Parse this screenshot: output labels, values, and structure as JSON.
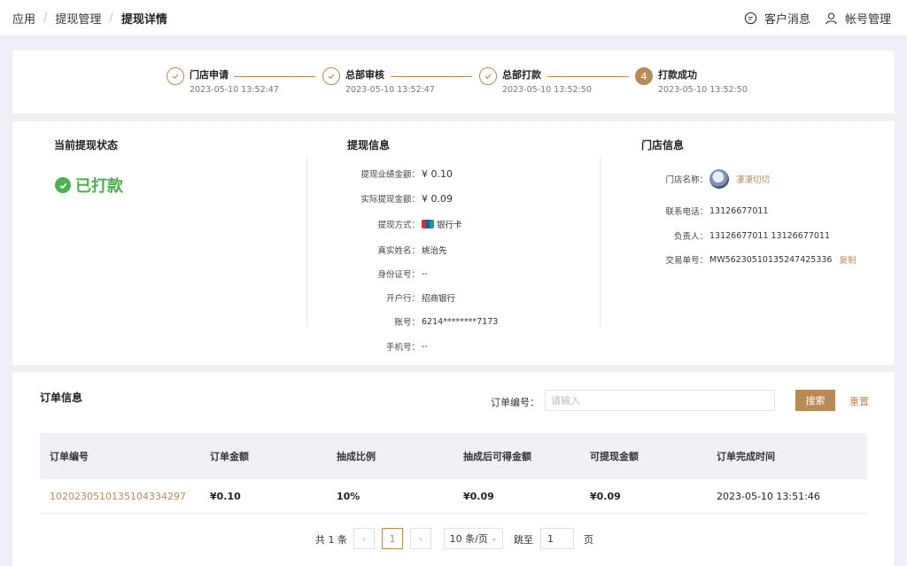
{
  "breadcrumb": {
    "items": [
      "应用",
      "提现管理"
    ],
    "current": "提现详情",
    "separator": "/"
  },
  "header": {
    "messages_label": "客户消息",
    "account_label": "帐号管理"
  },
  "steps": [
    {
      "title": "门店申请",
      "time": "2023-05-10 13:52:47",
      "state": "done"
    },
    {
      "title": "总部审核",
      "time": "2023-05-10 13:52:47",
      "state": "done"
    },
    {
      "title": "总部打款",
      "time": "2023-05-10 13:52:50",
      "state": "done"
    },
    {
      "title": "打款成功",
      "time": "2023-05-10 13:52:50",
      "state": "current",
      "number": "4"
    }
  ],
  "status_section": {
    "title": "当前提现状态",
    "status": "已打款"
  },
  "withdraw_info": {
    "title": "提现信息",
    "rows": [
      {
        "label": "提现业绩金额：",
        "value": "¥ 0.10"
      },
      {
        "label": "实际提现金额：",
        "value": "¥ 0.09"
      },
      {
        "label": "提现方式：",
        "value": "银行卡"
      },
      {
        "label": "真实姓名：",
        "value": "姚治先"
      },
      {
        "label": "身份证号：",
        "value": "--"
      },
      {
        "label": "开户行：",
        "value": "招商银行"
      },
      {
        "label": "账号：",
        "value": "6214********7173"
      },
      {
        "label": "手机号：",
        "value": "--"
      }
    ]
  },
  "store_info": {
    "title": "门店信息",
    "rows": [
      {
        "label": "门店名称：",
        "value": "凄凄切切"
      },
      {
        "label": "联系电话：",
        "value": "13126677011"
      },
      {
        "label": "负责人：",
        "value": "13126677011 13126677011"
      },
      {
        "label": "交易单号：",
        "value": "MW562305101352474253​36",
        "action": "复制"
      }
    ]
  },
  "orders": {
    "title": "订单信息",
    "search_label": "订单编号：",
    "search_placeholder": "请输入",
    "search_button": "搜索",
    "reset_button": "重置",
    "columns": [
      "订单编号",
      "订单金额",
      "抽成比例",
      "抽成后可得金额",
      "可提现金额",
      "订单完成时间"
    ],
    "rows": [
      [
        "102023051013510433429​7",
        "¥0.10",
        "10%",
        "¥0.09",
        "¥0.09",
        "2023-05-10 13:51:46"
      ]
    ]
  },
  "pagination": {
    "total": "共 1 条",
    "page": "1",
    "page_size": "10 条/页",
    "jump_label": "跳至",
    "jump_value": "1",
    "page_suffix": "页"
  },
  "colors": {
    "accent": "#b98a55",
    "success": "#4caf50"
  }
}
